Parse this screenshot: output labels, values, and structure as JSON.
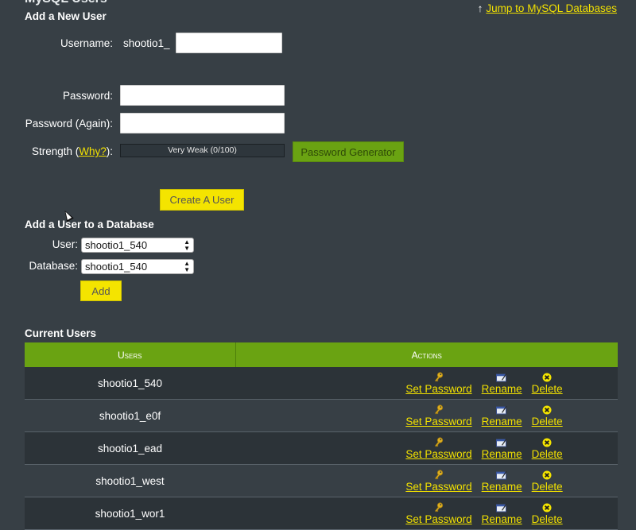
{
  "page": {
    "heading": "MySQL Users",
    "jump_arrow": "↑",
    "jump_link": "Jump to MySQL Databases"
  },
  "add_user": {
    "title": "Add a New User",
    "username_label": "Username:",
    "username_prefix": "shootio1_",
    "username_value": "",
    "password_label": "Password:",
    "password_again_label": "Password (Again):",
    "strength_label_before": "Strength (",
    "strength_why_link": "Why?",
    "strength_label_after": "):",
    "strength_value": "Very Weak (0/100)",
    "generator_button": "Password Generator",
    "create_button": "Create A User"
  },
  "add_to_db": {
    "title": "Add a User to a Database",
    "user_label": "User:",
    "user_selected": "shootio1_540",
    "database_label": "Database:",
    "database_selected": "shootio1_540",
    "add_button": "Add"
  },
  "current_users": {
    "title": "Current Users",
    "columns": [
      "Users",
      "Actions"
    ],
    "action_labels": {
      "set_password": "Set Password",
      "rename": "Rename",
      "delete": "Delete"
    },
    "rows": [
      {
        "user": "shootio1_540"
      },
      {
        "user": "shootio1_e0f"
      },
      {
        "user": "shootio1_ead"
      },
      {
        "user": "shootio1_west"
      },
      {
        "user": "shootio1_wor1"
      }
    ]
  },
  "icons": {
    "key": "key-icon",
    "rename": "rename-icon",
    "delete": "delete-icon"
  },
  "colors": {
    "background": "#373f45",
    "accent_green": "#6aa312",
    "accent_yellow": "#f4e400",
    "link_yellow": "#f2e100"
  }
}
